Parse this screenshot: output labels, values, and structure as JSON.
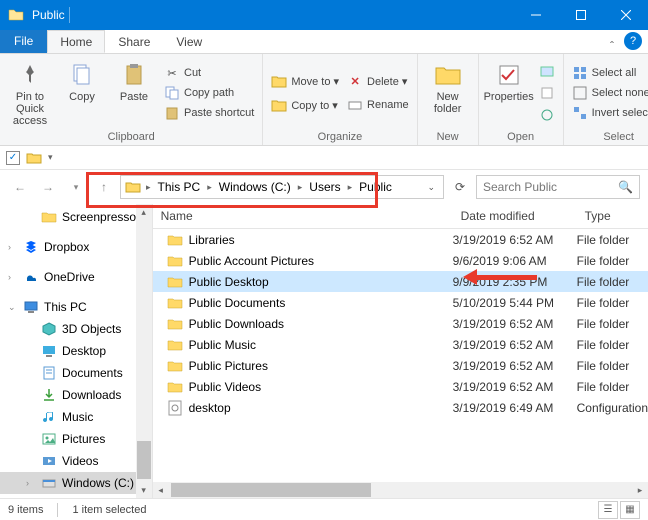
{
  "window": {
    "title": "Public"
  },
  "tabs": {
    "file": "File",
    "items": [
      "Home",
      "Share",
      "View"
    ],
    "activeIndex": 0
  },
  "ribbon": {
    "clipboard": {
      "label": "Clipboard",
      "pin": "Pin to Quick\naccess",
      "copy": "Copy",
      "paste": "Paste",
      "cut": "Cut",
      "copy_path": "Copy path",
      "paste_shortcut": "Paste shortcut"
    },
    "organize": {
      "label": "Organize",
      "move_to": "Move to ▾",
      "copy_to": "Copy to ▾",
      "delete": "Delete ▾",
      "rename": "Rename"
    },
    "new": {
      "label": "New",
      "new_folder": "New\nfolder"
    },
    "open": {
      "label": "Open",
      "properties": "Properties"
    },
    "select": {
      "label": "Select",
      "select_all": "Select all",
      "select_none": "Select none",
      "invert": "Invert selection"
    }
  },
  "breadcrumb": [
    "This PC",
    "Windows (C:)",
    "Users",
    "Public"
  ],
  "search": {
    "placeholder": "Search Public"
  },
  "sidebar": [
    {
      "label": "Screenpresso",
      "icon": "folder",
      "indent": true
    },
    {
      "label": "Dropbox",
      "icon": "dropbox",
      "expandable": true
    },
    {
      "label": "OneDrive",
      "icon": "onedrive",
      "expandable": true
    },
    {
      "label": "This PC",
      "icon": "thispc",
      "expandable": true,
      "expanded": true
    },
    {
      "label": "3D Objects",
      "icon": "3d",
      "indent": true
    },
    {
      "label": "Desktop",
      "icon": "desktop",
      "indent": true
    },
    {
      "label": "Documents",
      "icon": "documents",
      "indent": true
    },
    {
      "label": "Downloads",
      "icon": "downloads",
      "indent": true
    },
    {
      "label": "Music",
      "icon": "music",
      "indent": true
    },
    {
      "label": "Pictures",
      "icon": "pictures",
      "indent": true
    },
    {
      "label": "Videos",
      "icon": "videos",
      "indent": true
    },
    {
      "label": "Windows (C:)",
      "icon": "drive",
      "indent": true,
      "selected": true,
      "expandable": true
    }
  ],
  "columns": {
    "name": "Name",
    "date": "Date modified",
    "type": "Type"
  },
  "files": [
    {
      "name": "Libraries",
      "date": "3/19/2019 6:52 AM",
      "type": "File folder",
      "icon": "folder"
    },
    {
      "name": "Public Account Pictures",
      "date": "9/6/2019 9:06 AM",
      "type": "File folder",
      "icon": "folder"
    },
    {
      "name": "Public Desktop",
      "date": "9/9/2019 2:35 PM",
      "type": "File folder",
      "icon": "folder",
      "selected": true,
      "annotated": true
    },
    {
      "name": "Public Documents",
      "date": "5/10/2019 5:44 PM",
      "type": "File folder",
      "icon": "folder"
    },
    {
      "name": "Public Downloads",
      "date": "3/19/2019 6:52 AM",
      "type": "File folder",
      "icon": "folder"
    },
    {
      "name": "Public Music",
      "date": "3/19/2019 6:52 AM",
      "type": "File folder",
      "icon": "folder"
    },
    {
      "name": "Public Pictures",
      "date": "3/19/2019 6:52 AM",
      "type": "File folder",
      "icon": "folder"
    },
    {
      "name": "Public Videos",
      "date": "3/19/2019 6:52 AM",
      "type": "File folder",
      "icon": "folder"
    },
    {
      "name": "desktop",
      "date": "3/19/2019 6:49 AM",
      "type": "Configuration",
      "icon": "ini"
    }
  ],
  "status": {
    "count": "9 items",
    "selected": "1 item selected"
  }
}
